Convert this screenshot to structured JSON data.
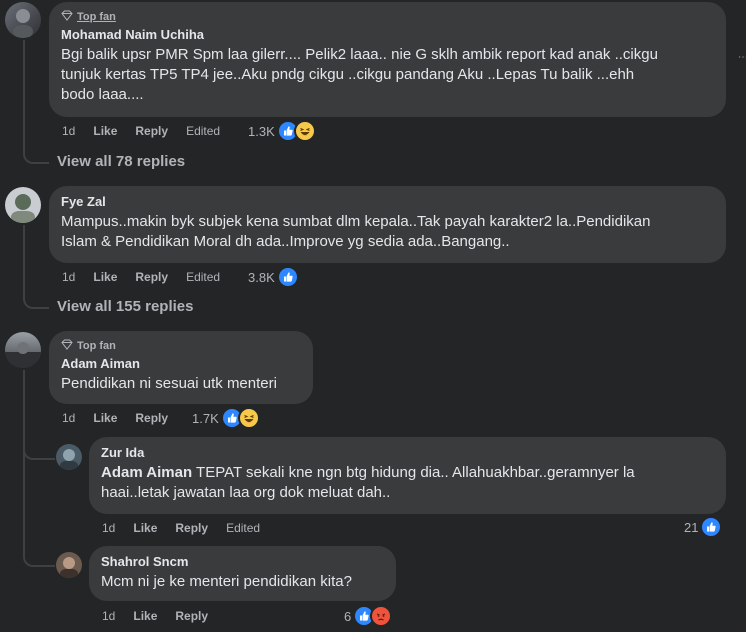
{
  "comments": [
    {
      "badge": "Top fan",
      "author": "Mohamad Naim Uchiha",
      "lines": [
        "Bgi balik upsr PMR Spm laa gilerr.... Pelik2 laaa.. nie G sklh ambik report kad anak ..cikgu",
        "tunjuk kertas TP5 TP4 jee..Aku pndg cikgu ..cikgu pandang Aku ..Lepas Tu balik ...ehh",
        "bodo laaa...."
      ],
      "time": "1d",
      "like": "Like",
      "reply": "Reply",
      "edited": "Edited",
      "count": "1.3K",
      "reactions": [
        "like-icon",
        "haha-icon"
      ]
    },
    {
      "author": "Fye Zal",
      "lines": [
        "Mampus..makin byk subjek kena sumbat dlm kepala..Tak payah karakter2 la..Pendidikan",
        "Islam & Pendidikan Moral dh ada..Improve yg sedia ada..Bangang.."
      ],
      "time": "1d",
      "like": "Like",
      "reply": "Reply",
      "edited": "Edited",
      "count": "3.8K",
      "reactions": [
        "like-icon"
      ]
    },
    {
      "badge": "Top fan",
      "author": "Adam Aiman",
      "lines": [
        "Pendidikan ni sesuai utk menteri"
      ],
      "time": "1d",
      "like": "Like",
      "reply": "Reply",
      "count": "1.7K",
      "reactions": [
        "like-icon",
        "haha-icon"
      ]
    }
  ],
  "replies_links": [
    "View all 78 replies",
    "View all 155 replies"
  ],
  "replies": [
    {
      "author": "Zur Ida",
      "mention": "Adam Aiman",
      "line1_rest": " TEPAT sekali kne ngn btg hidung dia.. Allahuakhbar..geramnyer la",
      "line2": "haai..letak jawatan laa org dok meluat dah..",
      "time": "1d",
      "like": "Like",
      "reply": "Reply",
      "edited": "Edited",
      "count": "21",
      "reactions": [
        "like-icon"
      ]
    },
    {
      "author": "Shahrol Sncm",
      "lines": [
        "Mcm ni je ke menteri pendidikan kita?"
      ],
      "time": "1d",
      "like": "Like",
      "reply": "Reply",
      "count": "6",
      "reactions": [
        "like-icon",
        "angry-icon"
      ]
    }
  ],
  "colors": {
    "background": "#242526",
    "bubble": "#3a3b3c",
    "text": "#e4e6eb",
    "muted": "#b0b3b8",
    "like_blue": "#2d88ff"
  }
}
